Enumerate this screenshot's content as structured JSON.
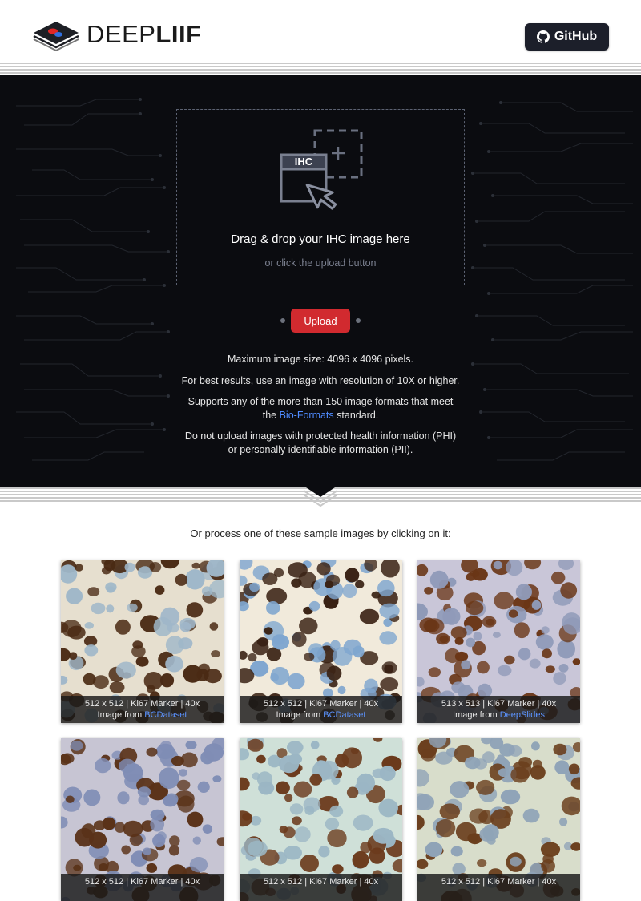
{
  "header": {
    "logo_light": "DEEP",
    "logo_bold": "LIIF",
    "github_label": "GitHub"
  },
  "upload": {
    "icon_label": "IHC",
    "drop_title": "Drag & drop your IHC image here",
    "drop_subtitle": "or click the upload button",
    "button_label": "Upload"
  },
  "info": {
    "line1": "Maximum image size: 4096 x 4096 pixels.",
    "line2": "For best results, use an image with resolution of 10X or higher.",
    "line3a": "Supports any of the more than 150 image formats that meet",
    "line3b_prefix": "the",
    "line3b_link": "Bio-Formats",
    "line3b_suffix": "standard.",
    "line4a": "Do not upload images with protected health information (PHI)",
    "line4b": "or personally identifiable information (PII)."
  },
  "samples": {
    "heading": "Or process one of these sample images by clicking on it:",
    "items": [
      {
        "info": "512 x 512  |  Ki67 Marker  |  40x",
        "source_prefix": "Image from",
        "source_link": "BCDataset",
        "bg": "#e6dfcf",
        "cell": "#4a2a14",
        "cell2": "#9fb7c9"
      },
      {
        "info": "512 x 512  |  Ki67 Marker  |  40x",
        "source_prefix": "Image from",
        "source_link": "BCDataset",
        "bg": "#f1eadb",
        "cell": "#7fa6cf",
        "cell2": "#3a2214"
      },
      {
        "info": "513 x 513  |  Ki67 Marker  |  40x",
        "source_prefix": "Image from",
        "source_link": "DeepSlides",
        "bg": "#c9c6d8",
        "cell": "#6a3616",
        "cell2": "#8f9ab8"
      },
      {
        "info": "512 x 512  |  Ki67 Marker  |  40x",
        "source_prefix": "",
        "source_link": "",
        "bg": "#c7c5d3",
        "cell": "#5a3218",
        "cell2": "#7f8db5"
      },
      {
        "info": "512 x 512  |  Ki67 Marker  |  40x",
        "source_prefix": "",
        "source_link": "",
        "bg": "#cfe0d8",
        "cell": "#9bb6c4",
        "cell2": "#6b3a1c"
      },
      {
        "info": "512 x 512  |  Ki67 Marker  |  40x",
        "source_prefix": "",
        "source_link": "",
        "bg": "#d8ddcb",
        "cell": "#6a3e1c",
        "cell2": "#8fa3b7"
      }
    ]
  },
  "colors": {
    "hero_bg": "#0b0c10",
    "upload_button": "#d12a2f",
    "link": "#4f8bff",
    "github_button": "#1c1f2a"
  }
}
